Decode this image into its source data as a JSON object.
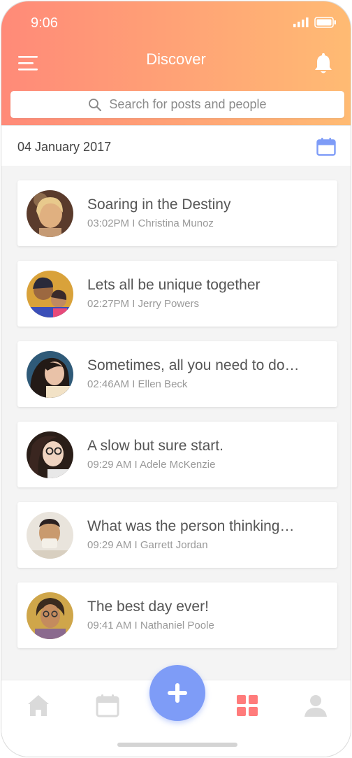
{
  "status_bar": {
    "time": "9:06"
  },
  "header": {
    "title": "Discover"
  },
  "search": {
    "placeholder": "Search for posts and people"
  },
  "date_bar": {
    "date": "04 January 2017"
  },
  "posts": [
    {
      "title": "Soaring in the Destiny",
      "meta": "03:02PM  I  Christina Munoz"
    },
    {
      "title": "Lets all be unique together",
      "meta": "02:27PM  I  Jerry Powers"
    },
    {
      "title": "Sometimes, all you need to do…",
      "meta": "02:46AM  I  Ellen Beck"
    },
    {
      "title": "A slow but sure start.",
      "meta": "09:29 AM  I Adele McKenzie"
    },
    {
      "title": "What was the person thinking…",
      "meta": "09:29 AM  I Garrett Jordan"
    },
    {
      "title": "The best day ever!",
      "meta": "09:41 AM  I Nathaniel Poole"
    }
  ],
  "tabs": [
    {
      "name": "home",
      "icon": "home-icon",
      "active": false
    },
    {
      "name": "calendar",
      "icon": "calendar-icon",
      "active": false
    },
    {
      "name": "add",
      "icon": "plus-icon",
      "active": false
    },
    {
      "name": "grid",
      "icon": "grid-icon",
      "active": true
    },
    {
      "name": "profile",
      "icon": "user-icon",
      "active": false
    }
  ],
  "colors": {
    "header_gradient_start": "#ff8a78",
    "header_gradient_end": "#ffbb73",
    "accent_blue": "#7e9cf7",
    "active_tab": "#ff7b7b",
    "inactive_tab": "#dadada"
  }
}
